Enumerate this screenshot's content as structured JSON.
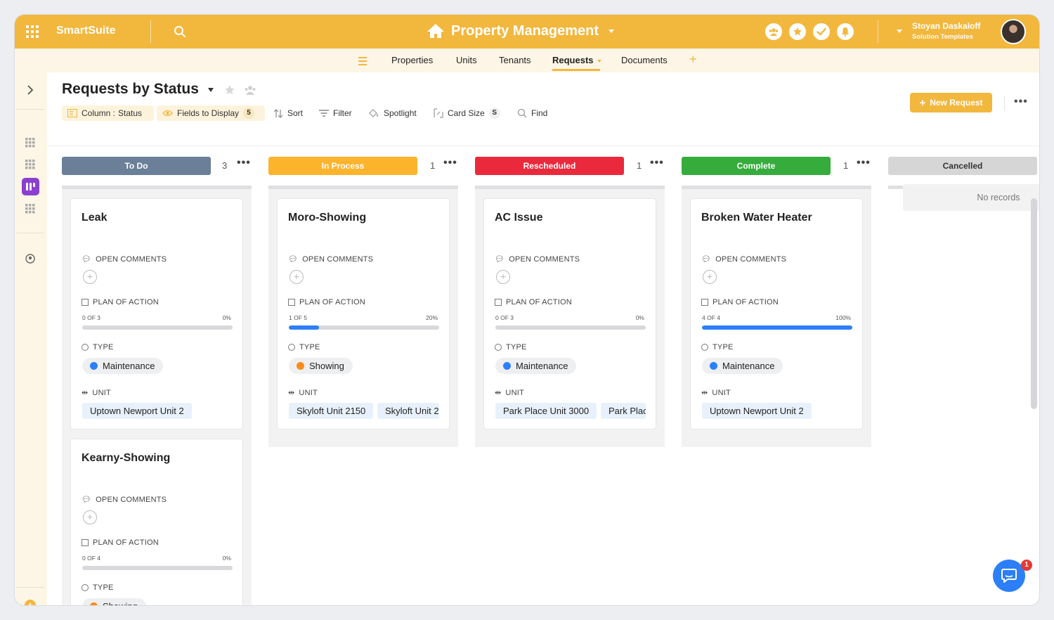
{
  "brand": "SmartSuite",
  "app_title": "Property Management",
  "user": {
    "name": "Stoyan Daskaloff",
    "role": "Solution Templates"
  },
  "nav_tabs": [
    "Properties",
    "Units",
    "Tenants",
    "Requests",
    "Documents"
  ],
  "active_tab": "Requests",
  "view": {
    "title": "Requests by Status",
    "new_button": "New Request"
  },
  "toolbar": {
    "column_label": "Column :",
    "column_value": "Status",
    "fields_label": "Fields to Display",
    "fields_count": "5",
    "sort": "Sort",
    "filter": "Filter",
    "spotlight": "Spotlight",
    "card_size": "Card Size",
    "card_size_value": "S",
    "find": "Find"
  },
  "colors": {
    "accent": "#f2b73d",
    "todo": "#6b7f98",
    "in_process": "#fcb42d",
    "rescheduled": "#ea2a3c",
    "complete": "#36ac3c",
    "cancelled": "#d6d6d6",
    "progress": "#2d7ff9"
  },
  "columns": [
    {
      "label": "To Do",
      "count": "3"
    },
    {
      "label": "In Process",
      "count": "1"
    },
    {
      "label": "Rescheduled",
      "count": "1"
    },
    {
      "label": "Complete",
      "count": "1"
    },
    {
      "label": "Cancelled",
      "count": "",
      "empty_text": "No records"
    }
  ],
  "field_labels": {
    "comments": "OPEN COMMENTS",
    "plan": "PLAN OF ACTION",
    "type": "TYPE",
    "unit": "UNIT"
  },
  "cards": {
    "leak": {
      "title": "Leak",
      "progress_text": "0 OF 3",
      "progress_pct": "0%",
      "progress": 0,
      "type": "Maintenance",
      "type_color": "#2d7ff9",
      "units": [
        "Uptown Newport Unit 2"
      ]
    },
    "kearny": {
      "title": "Kearny-Showing",
      "progress_text": "0 OF 4",
      "progress_pct": "0%",
      "progress": 0,
      "type": "Showing",
      "type_color": "#fb8c1a"
    },
    "moro": {
      "title": "Moro-Showing",
      "progress_text": "1 OF 5",
      "progress_pct": "20%",
      "progress": 0.2,
      "type": "Showing",
      "type_color": "#fb8c1a",
      "units": [
        "Skyloft Unit 2150",
        "Skyloft Unit 2"
      ]
    },
    "ac": {
      "title": "AC Issue",
      "progress_text": "0 OF 3",
      "progress_pct": "0%",
      "progress": 0,
      "type": "Maintenance",
      "type_color": "#2d7ff9",
      "units": [
        "Park Place Unit 3000",
        "Park Plac"
      ]
    },
    "heater": {
      "title": "Broken Water Heater",
      "progress_text": "4 OF 4",
      "progress_pct": "100%",
      "progress": 1,
      "type": "Maintenance",
      "type_color": "#2d7ff9",
      "units": [
        "Uptown Newport Unit 2"
      ]
    }
  },
  "chat_badge": "1"
}
